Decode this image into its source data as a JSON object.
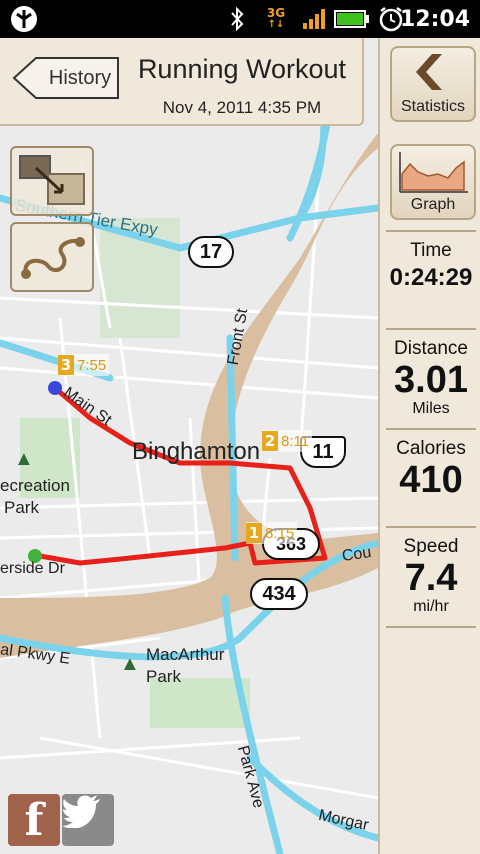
{
  "status_bar": {
    "clock": "12:04",
    "network": "3G",
    "icons": [
      "app-notification-icon",
      "bluetooth-icon",
      "3g-data-icon",
      "signal-icon",
      "battery-icon",
      "alarm-icon"
    ]
  },
  "header": {
    "back_label": "History",
    "title": "Running Workout",
    "datetime": "Nov 4, 2011 4:35 PM"
  },
  "sidebar": {
    "statistics_label": "Statistics",
    "graph_label": "Graph",
    "stats": [
      {
        "label": "Time",
        "value": "0:24:29",
        "unit": ""
      },
      {
        "label": "Distance",
        "value": "3.01",
        "unit": "Miles"
      },
      {
        "label": "Calories",
        "value": "410",
        "unit": ""
      },
      {
        "label": "Speed",
        "value": "7.4",
        "unit": "mi/hr"
      }
    ]
  },
  "map": {
    "labels": {
      "southern_tier": "Southern Tier Expy",
      "main_st": "Main St",
      "front_st": "Front St",
      "binghamton": "Binghamton",
      "recreation": "ecreation",
      "park": "Park",
      "riverside": "erside Dr",
      "court": "Cou",
      "pkwy": "al Pkwy E",
      "macarthur": "MacArthur",
      "macarthur_park": "Park",
      "park_ave": "Park Ave",
      "morgan": "Morgar"
    },
    "shields": [
      "17",
      "11",
      "363",
      "434"
    ],
    "splits": [
      {
        "number": "3",
        "time": "7:55"
      },
      {
        "number": "2",
        "time": "8:11"
      },
      {
        "number": "1",
        "time": "8:15"
      }
    ]
  },
  "social": {
    "facebook": "f",
    "twitter_icon": "twitter-bird-icon"
  },
  "colors": {
    "route": "#e8201a",
    "panel": "#f0e8da",
    "river": "#d9bfa0",
    "highway": "#7ad3ea"
  }
}
